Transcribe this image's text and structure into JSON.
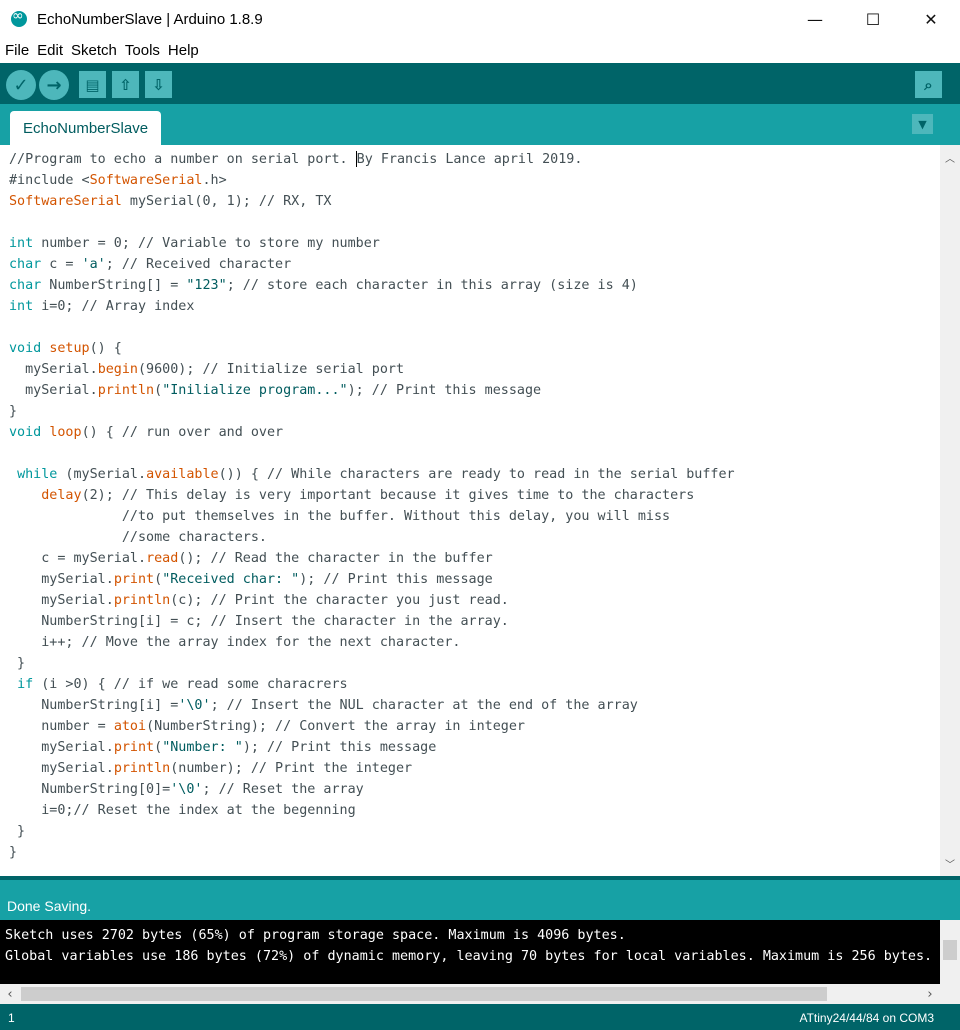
{
  "window": {
    "title": "EchoNumberSlave | Arduino 1.8.9",
    "minimize_glyph": "—",
    "maximize_glyph": "☐",
    "close_glyph": "✕"
  },
  "menu": [
    "File",
    "Edit",
    "Sketch",
    "Tools",
    "Help"
  ],
  "toolbar": {
    "verify_icon": "✓",
    "upload_icon": "→",
    "new_icon": "▤",
    "open_icon": "⇧",
    "save_icon": "⇩",
    "serial_monitor_icon": "⌕"
  },
  "tabs": [
    {
      "label": "EchoNumberSlave",
      "active": true
    }
  ],
  "tab_menu_icon": "▼",
  "editor": {
    "lines": [
      [
        {
          "t": "//Program to echo a number on serial port. ",
          "c": "cm"
        },
        {
          "t": "|cursor|",
          "c": "cursor"
        },
        {
          "t": "By Francis Lance april 2019.",
          "c": "cm"
        }
      ],
      [
        {
          "t": "#include <",
          "c": ""
        },
        {
          "t": "SoftwareSerial",
          "c": "fn"
        },
        {
          "t": ".h>",
          "c": ""
        }
      ],
      [
        {
          "t": "SoftwareSerial",
          "c": "fn"
        },
        {
          "t": " mySerial(0, 1); // RX, TX",
          "c": ""
        }
      ],
      [],
      [
        {
          "t": "int",
          "c": "kw"
        },
        {
          "t": " number = 0; // Variable to store my number",
          "c": ""
        }
      ],
      [
        {
          "t": "char",
          "c": "kw"
        },
        {
          "t": " c = ",
          "c": ""
        },
        {
          "t": "'a'",
          "c": "str"
        },
        {
          "t": "; // Received character",
          "c": ""
        }
      ],
      [
        {
          "t": "char",
          "c": "kw"
        },
        {
          "t": " NumberString[] = ",
          "c": ""
        },
        {
          "t": "\"123\"",
          "c": "str"
        },
        {
          "t": "; // store each character in this array (size is 4)",
          "c": ""
        }
      ],
      [
        {
          "t": "int",
          "c": "kw"
        },
        {
          "t": " i=0; // Array index",
          "c": ""
        }
      ],
      [],
      [
        {
          "t": "void",
          "c": "kw"
        },
        {
          "t": " ",
          "c": ""
        },
        {
          "t": "setup",
          "c": "fn"
        },
        {
          "t": "() {",
          "c": ""
        }
      ],
      [
        {
          "t": "  mySerial.",
          "c": ""
        },
        {
          "t": "begin",
          "c": "fn"
        },
        {
          "t": "(9600); // Initialize serial port",
          "c": ""
        }
      ],
      [
        {
          "t": "  mySerial.",
          "c": ""
        },
        {
          "t": "println",
          "c": "fn"
        },
        {
          "t": "(",
          "c": ""
        },
        {
          "t": "\"Inilialize program...\"",
          "c": "str"
        },
        {
          "t": "); // Print this message",
          "c": ""
        }
      ],
      [
        {
          "t": "}",
          "c": ""
        }
      ],
      [
        {
          "t": "void",
          "c": "kw"
        },
        {
          "t": " ",
          "c": ""
        },
        {
          "t": "loop",
          "c": "fn"
        },
        {
          "t": "() { // run over and over",
          "c": ""
        }
      ],
      [],
      [
        {
          "t": " ",
          "c": ""
        },
        {
          "t": "while",
          "c": "kw"
        },
        {
          "t": " (mySerial.",
          "c": ""
        },
        {
          "t": "available",
          "c": "fn"
        },
        {
          "t": "()) { // While characters are ready to read in the serial buffer",
          "c": ""
        }
      ],
      [
        {
          "t": "    ",
          "c": ""
        },
        {
          "t": "delay",
          "c": "fn"
        },
        {
          "t": "(2); // This delay is very important because it gives time to the characters",
          "c": ""
        }
      ],
      [
        {
          "t": "              //to put themselves in the buffer. Without this delay, you will miss",
          "c": ""
        }
      ],
      [
        {
          "t": "              //some characters.",
          "c": ""
        }
      ],
      [
        {
          "t": "    c = mySerial.",
          "c": ""
        },
        {
          "t": "read",
          "c": "fn"
        },
        {
          "t": "(); // Read the character in the buffer",
          "c": ""
        }
      ],
      [
        {
          "t": "    mySerial.",
          "c": ""
        },
        {
          "t": "print",
          "c": "fn"
        },
        {
          "t": "(",
          "c": ""
        },
        {
          "t": "\"Received char: \"",
          "c": "str"
        },
        {
          "t": "); // Print this message",
          "c": ""
        }
      ],
      [
        {
          "t": "    mySerial.",
          "c": ""
        },
        {
          "t": "println",
          "c": "fn"
        },
        {
          "t": "(c); // Print the character you just read.",
          "c": ""
        }
      ],
      [
        {
          "t": "    NumberString[i] = c; // Insert the character in the array.",
          "c": ""
        }
      ],
      [
        {
          "t": "    i++; // Move the array index for the next character.",
          "c": ""
        }
      ],
      [
        {
          "t": " }",
          "c": ""
        }
      ],
      [
        {
          "t": " ",
          "c": ""
        },
        {
          "t": "if",
          "c": "kw"
        },
        {
          "t": " (i >0) { // if we read some characrers",
          "c": ""
        }
      ],
      [
        {
          "t": "    NumberString[i] =",
          "c": ""
        },
        {
          "t": "'\\0'",
          "c": "str"
        },
        {
          "t": "; // Insert the NUL character at the end of the array",
          "c": ""
        }
      ],
      [
        {
          "t": "    number = ",
          "c": ""
        },
        {
          "t": "atoi",
          "c": "fn"
        },
        {
          "t": "(NumberString); // Convert the array in integer",
          "c": ""
        }
      ],
      [
        {
          "t": "    mySerial.",
          "c": ""
        },
        {
          "t": "print",
          "c": "fn"
        },
        {
          "t": "(",
          "c": ""
        },
        {
          "t": "\"Number: \"",
          "c": "str"
        },
        {
          "t": "); // Print this message",
          "c": ""
        }
      ],
      [
        {
          "t": "    mySerial.",
          "c": ""
        },
        {
          "t": "println",
          "c": "fn"
        },
        {
          "t": "(number); // Print the integer",
          "c": ""
        }
      ],
      [
        {
          "t": "    NumberString[0]=",
          "c": ""
        },
        {
          "t": "'\\0'",
          "c": "str"
        },
        {
          "t": "; // Reset the array",
          "c": ""
        }
      ],
      [
        {
          "t": "    i=0;// Reset the index at the begenning",
          "c": ""
        }
      ],
      [
        {
          "t": " }",
          "c": ""
        }
      ],
      [
        {
          "t": "}",
          "c": ""
        }
      ]
    ]
  },
  "status": {
    "text": "Done Saving."
  },
  "console": {
    "lines": [
      "Sketch uses 2702 bytes (65%) of program storage space. Maximum is 4096 bytes.",
      "Global variables use 186 bytes (72%) of dynamic memory, leaving 70 bytes for local variables. Maximum is 256 bytes."
    ]
  },
  "footer": {
    "line_number": "1",
    "board": "ATtiny24/44/84 on COM3"
  },
  "colors": {
    "teal_dark": "#006468",
    "teal_mid": "#17a1a5",
    "keyword": "#00979c",
    "function": "#d35400"
  }
}
